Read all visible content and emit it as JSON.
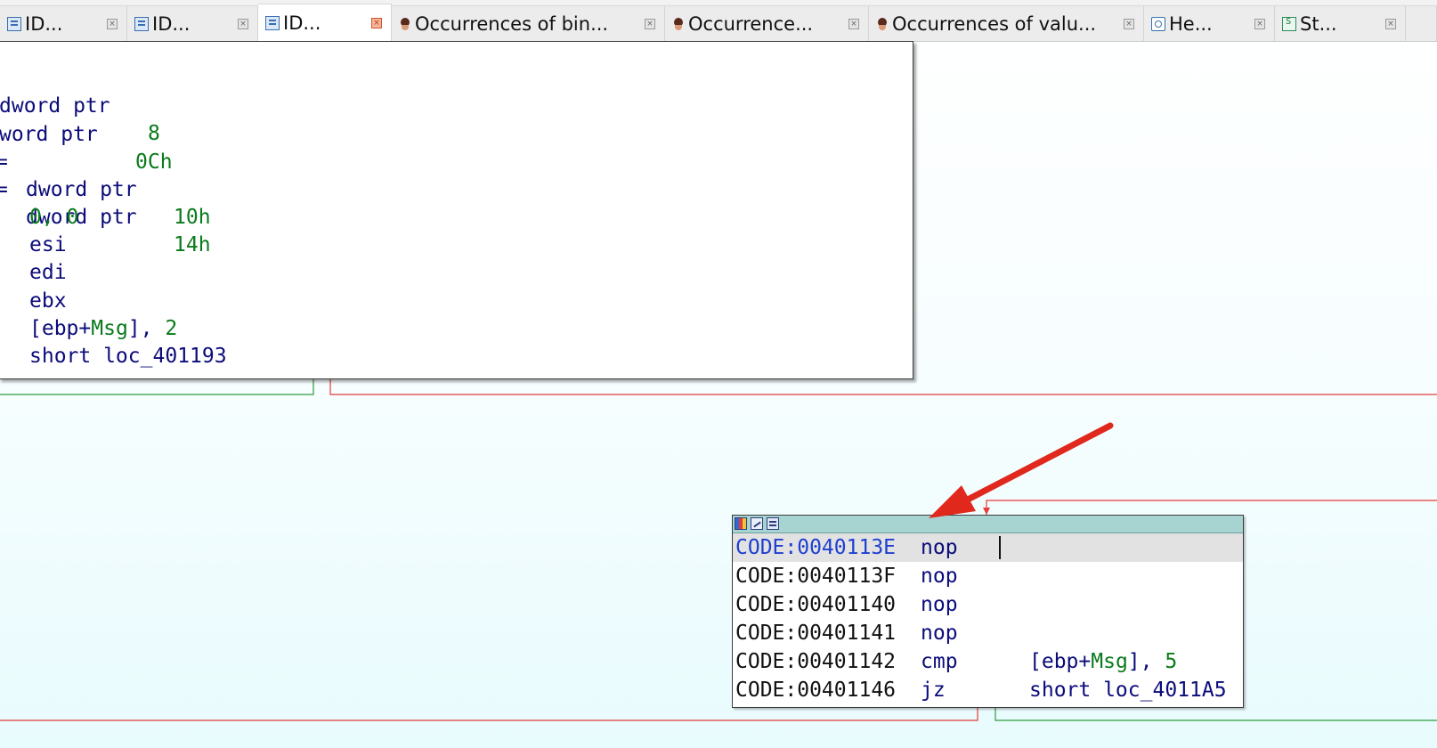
{
  "tabs": [
    {
      "label": "ID...",
      "icon": "ida-view-icon",
      "active": false
    },
    {
      "label": "ID...",
      "icon": "ida-view-icon",
      "active": false
    },
    {
      "label": "ID...",
      "icon": "ida-view-icon",
      "active": true
    },
    {
      "label": "Occurrences of bin...",
      "icon": "occurrences-icon",
      "active": false
    },
    {
      "label": "Occurrence...",
      "icon": "occurrences-icon",
      "active": false
    },
    {
      "label": "Occurrences of valu...",
      "icon": "occurrences-icon",
      "active": false
    },
    {
      "label": "He...",
      "icon": "hex-view-icon",
      "active": false
    },
    {
      "label": "St...",
      "icon": "strings-icon",
      "active": false
    }
  ],
  "top_block": {
    "lines": [
      {
        "prefix": "",
        "kw": "dword ptr",
        "num": "8"
      },
      {
        "prefix": "",
        "kw": "word ptr",
        "num": "0Ch"
      },
      {
        "prefix": "=",
        "kw": "dword ptr",
        "num": "10h"
      },
      {
        "prefix": "=",
        "kw": "dword ptr",
        "num": "14h"
      }
    ],
    "instr_lines": [
      {
        "parts": [
          {
            "t": "0, 0",
            "c": "num"
          }
        ]
      },
      {
        "parts": [
          {
            "t": "esi",
            "c": "plain"
          }
        ]
      },
      {
        "parts": [
          {
            "t": "edi",
            "c": "plain"
          }
        ]
      },
      {
        "parts": [
          {
            "t": "ebx",
            "c": "plain"
          }
        ]
      },
      {
        "parts": [
          {
            "t": "[ebp+",
            "c": "plain"
          },
          {
            "t": "Msg",
            "c": "sym"
          },
          {
            "t": "], ",
            "c": "plain"
          },
          {
            "t": "2",
            "c": "num"
          }
        ]
      },
      {
        "parts": [
          {
            "t": "short loc_401193",
            "c": "plain"
          }
        ]
      }
    ]
  },
  "lower_block": {
    "rows": [
      {
        "addr": "CODE:0040113E",
        "mnem": "nop",
        "ops": "",
        "selected": true
      },
      {
        "addr": "CODE:0040113F",
        "mnem": "nop",
        "ops": "",
        "selected": false
      },
      {
        "addr": "CODE:00401140",
        "mnem": "nop",
        "ops": "",
        "selected": false
      },
      {
        "addr": "CODE:00401141",
        "mnem": "nop",
        "ops": "",
        "selected": false
      },
      {
        "addr": "CODE:00401142",
        "mnem": "cmp",
        "ops_parts": [
          {
            "t": "[ebp+",
            "c": "plain"
          },
          {
            "t": "Msg",
            "c": "sym"
          },
          {
            "t": "], ",
            "c": "plain"
          },
          {
            "t": "5",
            "c": "num"
          }
        ],
        "selected": false
      },
      {
        "addr": "CODE:00401146",
        "mnem": "jz",
        "ops": "short loc_4011A5",
        "selected": false
      }
    ],
    "header_icons": [
      "graph-overview-icon",
      "edit-icon",
      "text-view-icon"
    ]
  },
  "colors": {
    "edge_true": "#2e9e3e",
    "edge_false": "#e53b3b",
    "annotation_arrow": "#e0281c",
    "header_bar": "#a7d4d1"
  }
}
